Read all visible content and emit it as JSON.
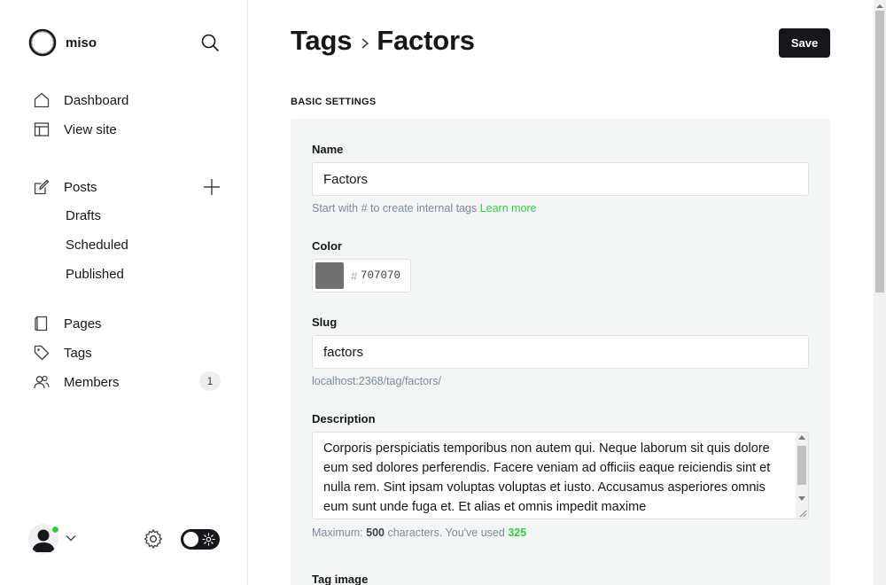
{
  "brand": {
    "name": "miso"
  },
  "sidebar": {
    "nav_main": [
      {
        "label": "Dashboard",
        "icon": "home-icon"
      },
      {
        "label": "View site",
        "icon": "layout-icon"
      }
    ],
    "posts": {
      "label": "Posts",
      "icon": "edit-icon",
      "sub_items": [
        "Drafts",
        "Scheduled",
        "Published"
      ]
    },
    "nav_secondary": [
      {
        "label": "Pages",
        "icon": "page-icon"
      },
      {
        "label": "Tags",
        "icon": "tag-icon"
      },
      {
        "label": "Members",
        "icon": "members-icon",
        "badge": "1"
      }
    ]
  },
  "header": {
    "breadcrumb_parent": "Tags",
    "breadcrumb_current": "Factors",
    "save_label": "Save"
  },
  "form": {
    "section_heading": "BASIC SETTINGS",
    "name": {
      "label": "Name",
      "value": "Factors",
      "hint": "Start with # to create internal tags",
      "hint_link": "Learn more"
    },
    "color": {
      "label": "Color",
      "hash": "#",
      "value": "707070",
      "swatch_color": "#707070"
    },
    "slug": {
      "label": "Slug",
      "value": "factors",
      "hint": "localhost:2368/tag/factors/"
    },
    "description": {
      "label": "Description",
      "value": "Corporis perspiciatis temporibus non autem qui. Neque laborum sit quis dolore eum sed dolores perferendis. Facere veniam ad officiis eaque reiciendis sint et nulla rem. Sint ipsam voluptas voluptas et iusto. Accusamus asperiores omnis eum sunt unde fuga et. Et alias et omnis impedit maxime",
      "hint_prefix": "Maximum:",
      "max": "500",
      "hint_middle": "characters. You've used",
      "used": "325"
    },
    "tag_image": {
      "label": "Tag image"
    }
  },
  "colors": {
    "accent_green": "#30cf43",
    "primary_dark": "#15171a"
  }
}
